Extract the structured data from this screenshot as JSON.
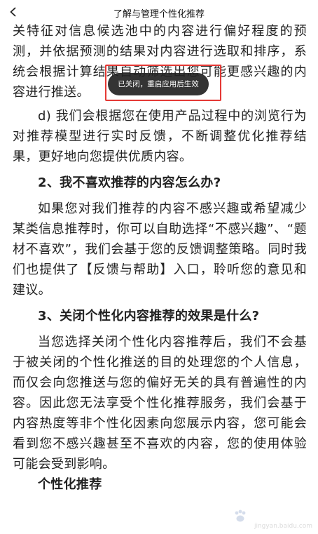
{
  "header": {
    "title": "了解与管理个性化推荐",
    "back_icon": "chevron-left-icon"
  },
  "article": {
    "p1": "关特征对信息候选池中的内容进行偏好程度的预测，并依据预测的结果对内容进行选取和排序，系统会根据计算结果自动筛选出您可能更感兴趣的内容进行推送。",
    "p2": "d) 我们会根据您在使用产品过程中的浏览行为对推荐模型进行实时反馈，不断调整优化推荐结果，更好地向您提供优质内容。",
    "h2": "2、我不喜欢推荐的内容怎么办?",
    "p3": "如果您对我们推荐的内容不感兴趣或希望减少某类信息推荐时，你可以自助选择“不感兴趣”、“题材不喜欢”，我们会基于您的反馈调整策略。同时我们也提供了【反馈与帮助】入口，聆听您的意见和建议。",
    "h3": "3、关闭个性化内容推荐的效果是什么?",
    "p4": "当您选择关闭个性化内容推荐后，我们不会基于被关闭的个性化推送的目的处理您的个人信息，而仅会向您推送与您的偏好无关的具有普遍性的内容。因此您无法享受个性化推荐服务，我们会基于内容热度等非个性化因素向您展示内容，您可能会看到您不感兴趣甚至不喜欢的内容，您的使用体验可能会受到影响。",
    "section_title": "个性化推荐"
  },
  "toast": {
    "text": "已关闭，重启应用后生效"
  },
  "watermark": {
    "text": "jingyan.baidu.com",
    "icon": "baidu-paw-icon"
  },
  "colors": {
    "toast_bg": "#232323",
    "annotation": "#e53935"
  }
}
